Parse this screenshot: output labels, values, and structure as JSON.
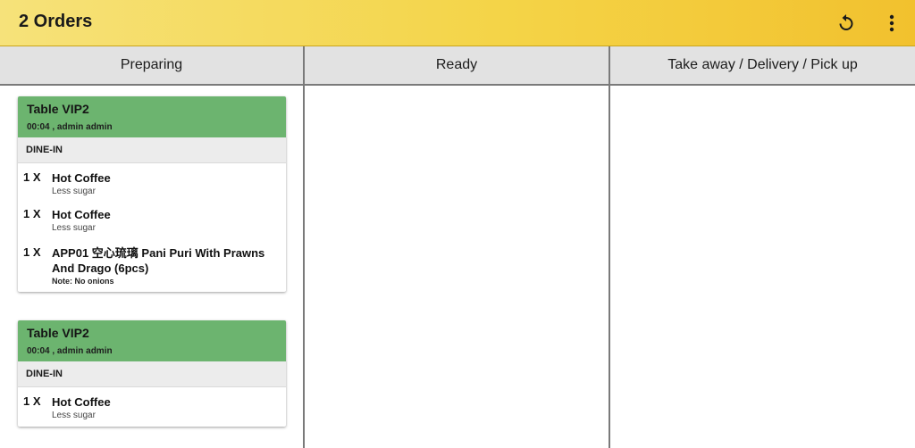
{
  "appbar": {
    "title": "2 Orders",
    "refresh_icon": "refresh-icon",
    "more_icon": "more-vert-icon",
    "colors": {
      "gradient_start": "#f6e27a",
      "gradient_end": "#f2c12e"
    }
  },
  "columns": [
    {
      "label": "Preparing"
    },
    {
      "label": "Ready"
    },
    {
      "label": "Take away / Delivery / Pick up"
    }
  ],
  "orders": [
    {
      "table": "Table VIP2",
      "meta": "00:04  , admin admin",
      "type": "DINE-IN",
      "header_color": "#6cb46f",
      "items": [
        {
          "qty": "1 X",
          "name": "Hot Coffee",
          "sub": "Less sugar",
          "note": ""
        },
        {
          "qty": "1 X",
          "name": "Hot Coffee",
          "sub": "Less sugar",
          "note": ""
        },
        {
          "qty": "1 X",
          "name": "APP01 空心琉璃  Pani Puri With Prawns And Drago (6pcs)",
          "sub": "",
          "note": "Note: No onions"
        }
      ]
    },
    {
      "table": "Table VIP2",
      "meta": "00:04  , admin admin",
      "type": "DINE-IN",
      "header_color": "#6cb46f",
      "items": [
        {
          "qty": "1 X",
          "name": "Hot Coffee",
          "sub": "Less sugar",
          "note": ""
        }
      ]
    }
  ]
}
